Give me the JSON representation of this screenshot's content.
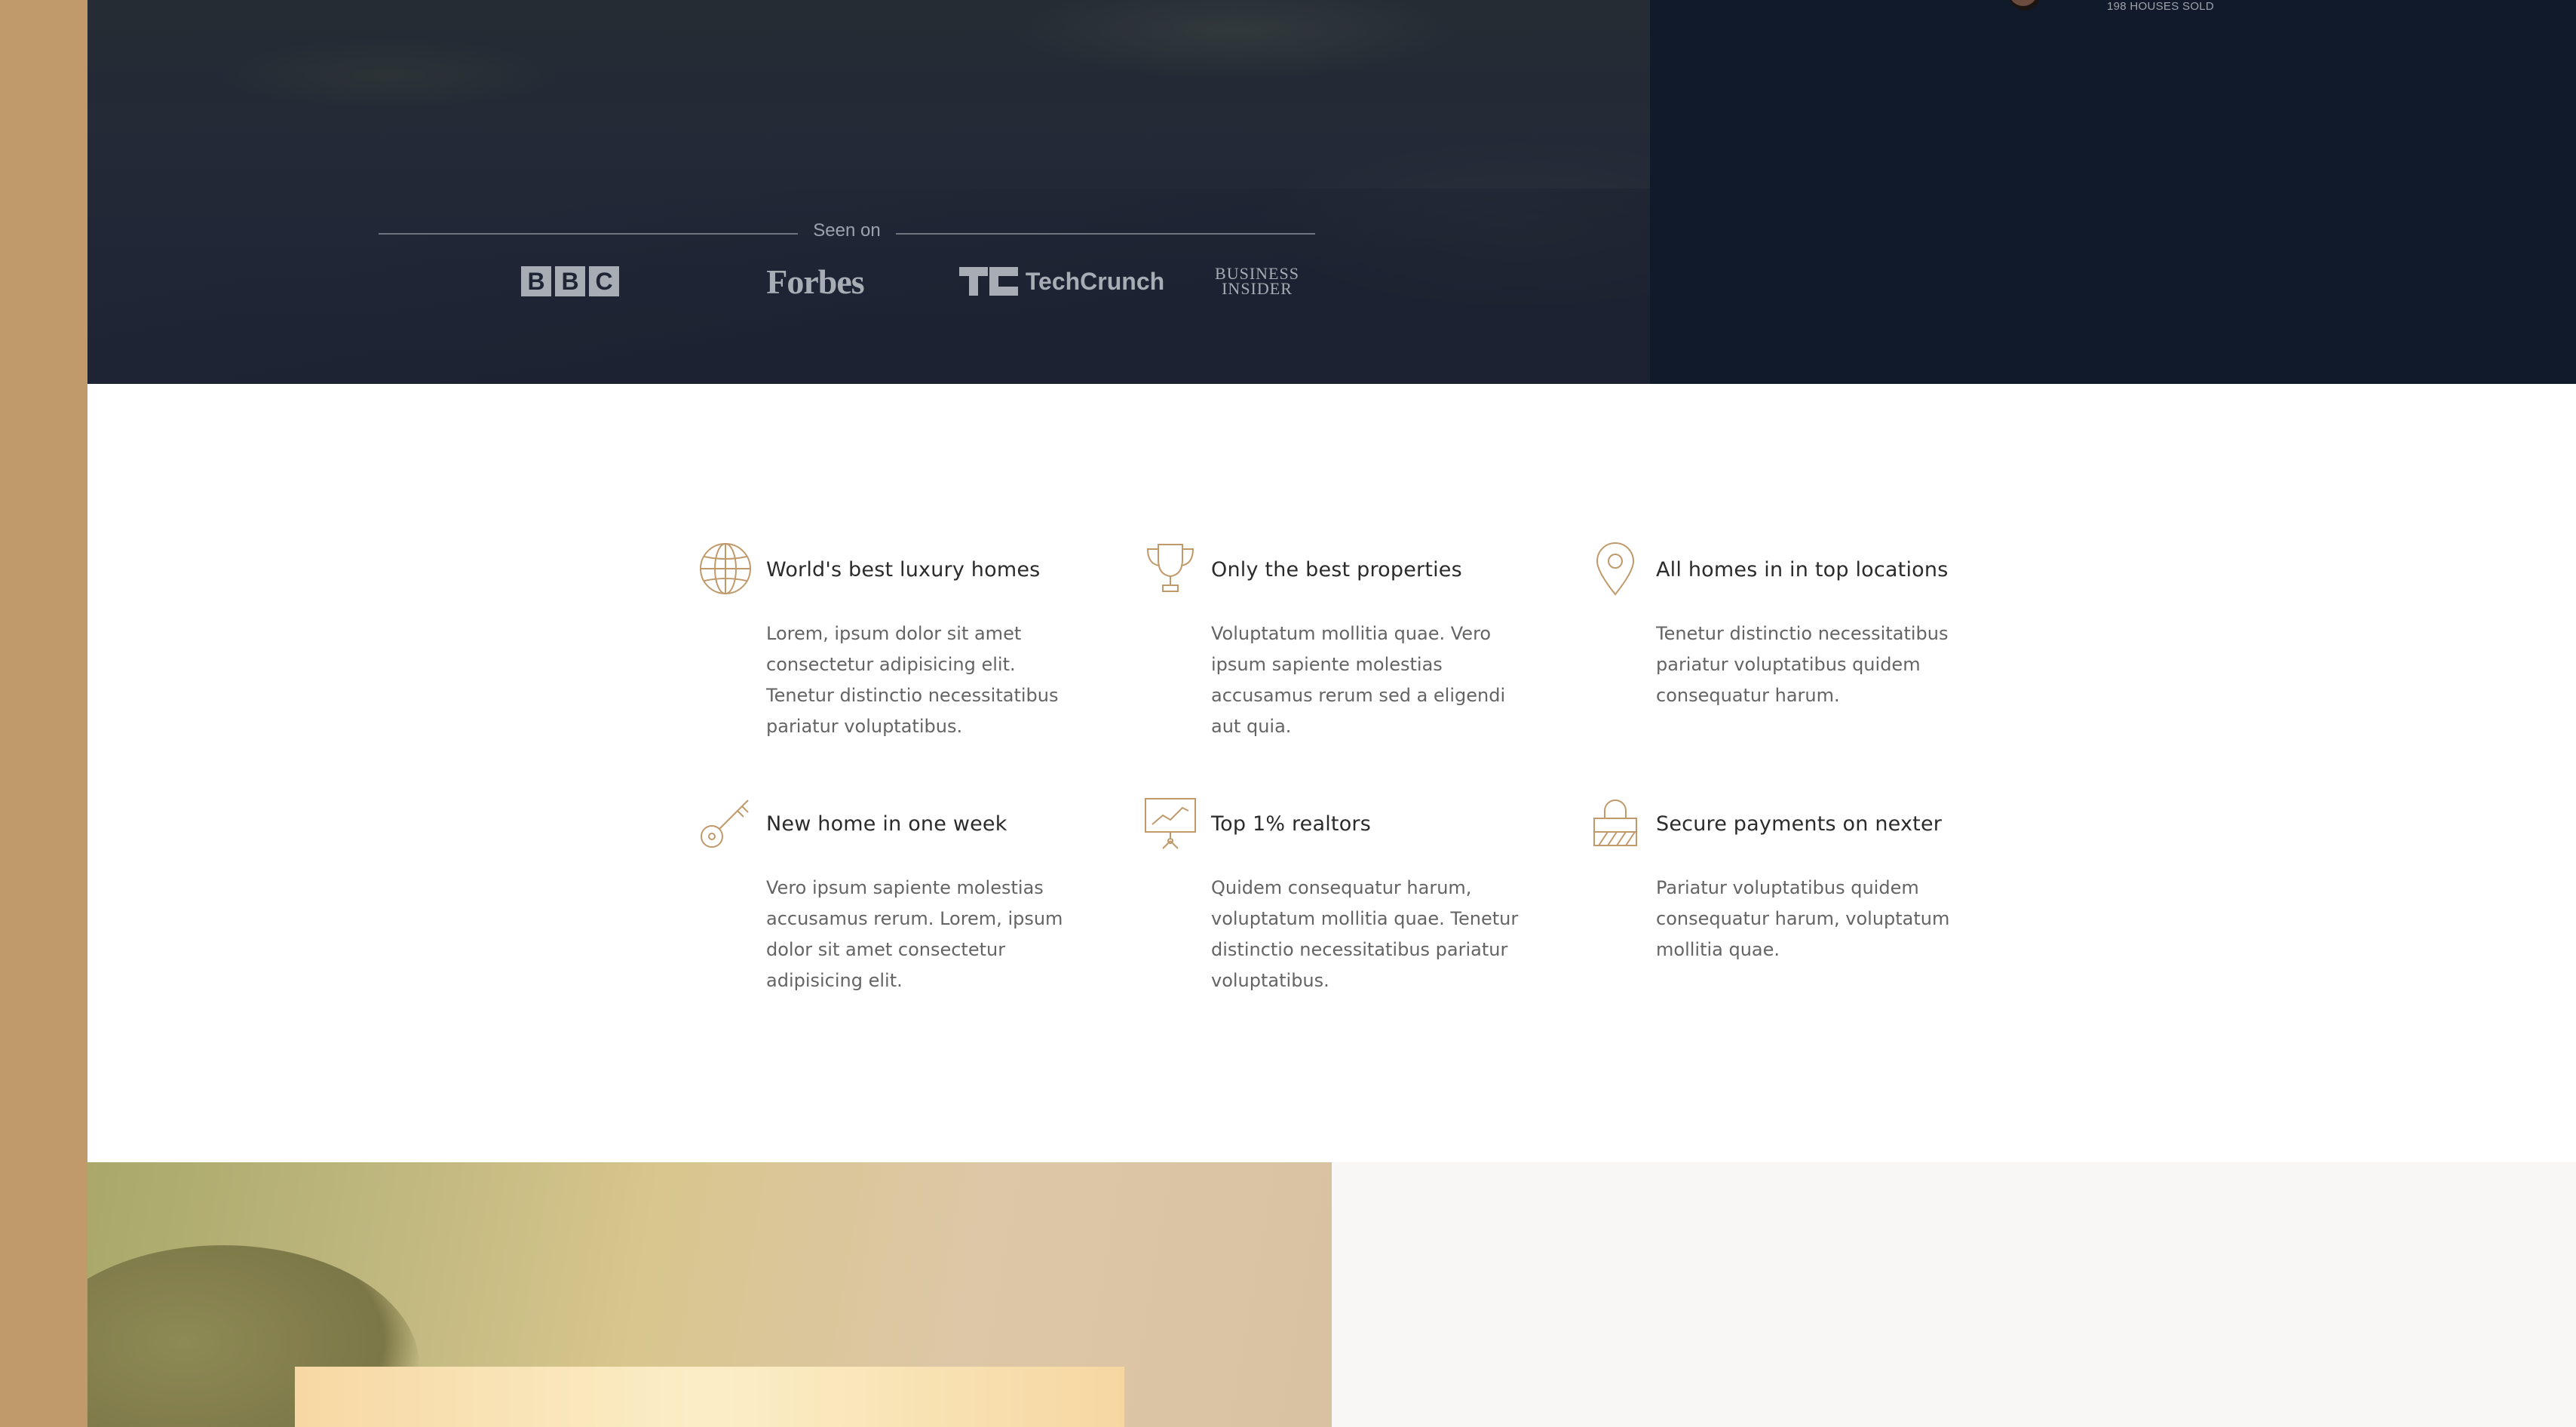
{
  "hero": {
    "agent_sold": "198 HOUSES SOLD",
    "seen_on_label": "Seen on",
    "logos": {
      "bbc": [
        "B",
        "B",
        "C"
      ],
      "forbes": "Forbes",
      "techcrunch": "TechCrunch",
      "business_insider_line1": "BUSINESS",
      "business_insider_line2": "INSIDER"
    }
  },
  "features": [
    {
      "icon": "globe-icon",
      "title": "World's best luxury homes",
      "text": "Lorem, ipsum dolor sit amet consectetur adipisicing elit. Tenetur distinctio necessitatibus pariatur voluptatibus."
    },
    {
      "icon": "trophy-icon",
      "title": "Only the best properties",
      "text": "Voluptatum mollitia quae. Vero ipsum sapiente molestias accusamus rerum sed a eligendi aut quia."
    },
    {
      "icon": "map-pin-icon",
      "title": "All homes in in top locations",
      "text": "Tenetur distinctio necessitatibus pariatur voluptatibus quidem consequatur harum."
    },
    {
      "icon": "key-icon",
      "title": "New home in one week",
      "text": "Vero ipsum sapiente molestias accusamus rerum. Lorem, ipsum dolor sit amet consectetur adipisicing elit."
    },
    {
      "icon": "presentation-chart-icon",
      "title": "Top 1% realtors",
      "text": "Quidem consequatur harum, voluptatum mollitia quae. Tenetur distinctio necessitatibus pariatur voluptatibus."
    },
    {
      "icon": "lock-icon",
      "title": "Secure payments on nexter",
      "text": "Pariatur voluptatibus quidem consequatur harum, voluptatum mollitia quae."
    }
  ],
  "colors": {
    "sidebar": "#c19a6b",
    "hero_dark": "#101a2b",
    "icon_accent": "#c19a6b",
    "heading": "#2b2b2b",
    "body_text": "#646464"
  }
}
